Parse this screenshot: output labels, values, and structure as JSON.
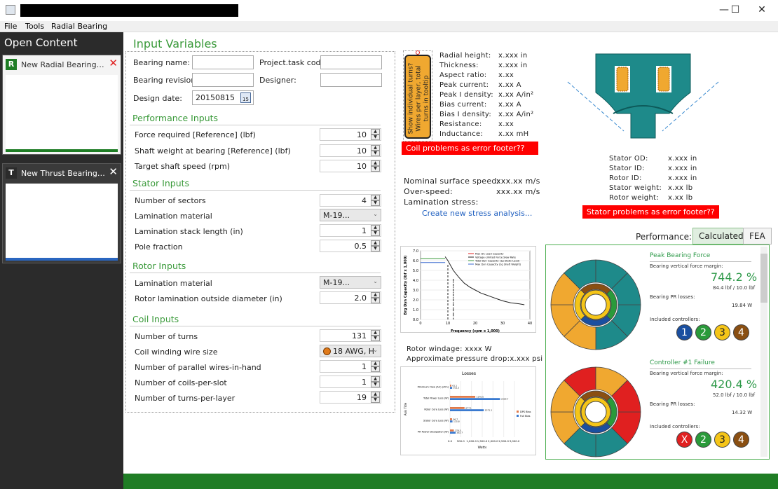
{
  "window": {
    "minimize": "—",
    "maximize": "☐",
    "close": "✕"
  },
  "menu": [
    "File",
    "Tools",
    "Radial Bearing"
  ],
  "sidebar": {
    "title": "Open Content",
    "cards": [
      {
        "badge": "R",
        "title": "New Radial Bearing Desi..."
      },
      {
        "badge": "T",
        "title": "New Thrust Bearing Des..."
      }
    ]
  },
  "input_vars": {
    "title": "Input Variables",
    "bearing_name_label": "Bearing name:",
    "project_task_label": "Project.task code:",
    "bearing_revision_label": "Bearing revision:",
    "designer_label": "Designer:",
    "design_date_label": "Design date:",
    "design_date": "20150815",
    "cal_num": "15",
    "sections": {
      "performance": "Performance Inputs",
      "stator": "Stator Inputs",
      "rotor": "Rotor Inputs",
      "coil": "Coil Inputs"
    },
    "performance": [
      {
        "label": "Force required [Reference] (lbf)",
        "value": "10"
      },
      {
        "label": "Shaft weight at bearing [Reference] (lbf)",
        "value": "10"
      },
      {
        "label": "Target shaft speed (rpm)",
        "value": "10"
      }
    ],
    "stator": {
      "sectors_label": "Number of sectors",
      "sectors": "4",
      "lam_label": "Lamination material",
      "lam_value": "M-19...",
      "stack_label": "Lamination stack length (in)",
      "stack": "1",
      "pole_label": "Pole fraction",
      "pole": "0.5"
    },
    "rotor": {
      "lam_label": "Lamination material",
      "lam_value": "M-19...",
      "od_label": "Rotor lamination outside diameter (in)",
      "od": "2.0"
    },
    "coil": {
      "turns_label": "Number of turns",
      "turns": "131",
      "wire_label": "Coil winding wire size",
      "wire": "18 AWG, H",
      "parallel_label": "Number of parallel wires-in-hand",
      "parallel": "1",
      "coils_label": "Number of coils-per-slot",
      "coils": "1",
      "layer_label": "Number of turns-per-layer",
      "layer": "19"
    }
  },
  "coil_tooltip": "Show individual turns? Wires per layer, total turns in tooltip",
  "coil_props": [
    [
      "Radial height:",
      "x.xxx in"
    ],
    [
      "Thickness:",
      "x.xxx in"
    ],
    [
      "Aspect ratio:",
      "x.xx"
    ],
    [
      "Peak current:",
      "x.xx A"
    ],
    [
      "Peak I density:",
      "x.xx A/in²"
    ],
    [
      "Bias current:",
      "x.xx A"
    ],
    [
      "Bias I density:",
      "x.xx A/in²"
    ],
    [
      "Resistance:",
      "x.xx"
    ],
    [
      "Inductance:",
      "x.xx mH"
    ]
  ],
  "coil_error": "Coil problems as error footer??",
  "surface": [
    [
      "Nominal surface speed:",
      "xxx.xx m/s"
    ],
    [
      "Over-speed:",
      "xxx.xx m/s"
    ],
    [
      "Lamination stress:",
      ""
    ]
  ],
  "stress_link": "Create new stress analysis...",
  "stator_props": [
    [
      "Stator OD:",
      "x.xxx in"
    ],
    [
      "Stator ID:",
      "x.xxx in"
    ],
    [
      "Rotor ID:",
      "x.xxx in"
    ],
    [
      "Stator weight:",
      "x.xx lb"
    ],
    [
      "Rotor weight:",
      "x.xx lb"
    ]
  ],
  "stator_error": "Stator problems as error footer??",
  "performance_panel": {
    "label": "Performance:",
    "tab_calc": "Calculated",
    "tab_fea": "FEA",
    "blocks": [
      {
        "title": "Peak Bearing Force",
        "margin_label": "Bearing vertical force margin:",
        "pct": "744.2 %",
        "sub": "84.4 lbf / 10.0 lbf",
        "loss_label": "Bearing PR losses:",
        "loss": "19.84 W",
        "ctrl_label": "Included controllers:",
        "ctrls": [
          "1",
          "2",
          "3",
          "4"
        ]
      },
      {
        "title": "Controller #1 Failure",
        "margin_label": "Bearing vertical force margin:",
        "pct": "420.4 %",
        "sub": "52.0 lbf / 10.0 lbf",
        "loss_label": "Bearing PR losses:",
        "loss": "14.32 W",
        "ctrl_label": "Included controllers:",
        "ctrls": [
          "X",
          "2",
          "3",
          "4"
        ]
      }
    ]
  },
  "windage": {
    "label": "Rotor windage:",
    "value": "xxxx W"
  },
  "pressure": {
    "label": "Approximate pressure drop:",
    "value": "x.xxx psi"
  },
  "colors": {
    "accent": "#3a9a3a",
    "ctrl1": "#1a4fa0",
    "ctrl2": "#2a9a3a",
    "ctrl3": "#f5c518",
    "ctrl4": "#8a4f12",
    "fail": "#e02020"
  },
  "chart_data": [
    {
      "type": "line",
      "ylabel": "Brg Dyn Capacity (lbf x 1,000)",
      "xlabel": "Frequency (cpm x 1,000)",
      "ylim": [
        0,
        7
      ],
      "xlim": [
        0,
        40
      ],
      "yticks": [
        "0.0",
        "1.0",
        "2.0",
        "3.0",
        "4.0",
        "5.0",
        "6.0",
        "7.0"
      ],
      "xticks": [
        "0",
        "10",
        "20",
        "30",
        "40"
      ],
      "legend": [
        "Max DC Load Capacity",
        "Voltage-Limited Force Slew Rate",
        "Total Dyn Capacity (1g Static Load)",
        "Max Dyn Capacity (1g Shaft Weight)"
      ],
      "series": [
        {
          "name": "Voltage-Limited Force Slew Rate",
          "x": [
            9,
            10,
            12,
            14,
            16,
            18,
            20,
            22,
            24,
            26,
            28,
            30,
            33,
            36,
            38
          ],
          "y": [
            6.4,
            6.0,
            5.0,
            4.3,
            3.7,
            3.3,
            3.0,
            2.7,
            2.5,
            2.3,
            2.1,
            1.9,
            1.7,
            1.6,
            1.5
          ]
        },
        {
          "name": "Total Dyn Capacity (1g Static Load)",
          "x": [
            0,
            9
          ],
          "y": [
            6.2,
            6.2
          ]
        },
        {
          "name": "Max Dyn Capacity (1g Shaft Weight)",
          "x": [
            0,
            9
          ],
          "y": [
            5.8,
            5.8
          ]
        }
      ]
    },
    {
      "type": "bar",
      "title": "Losses",
      "ylabel": "Axis Title",
      "xlabel": "Watts",
      "xticks": [
        "0.0",
        "500.0",
        "1,000.0",
        "1,500.0",
        "2,000.0",
        "2,500.0",
        "3,000.0"
      ],
      "categories": [
        "Minimum Flow (Air) (cfm)",
        "Total Power Loss (W)",
        "Rotor Core Loss (W)",
        "Stator Core Loss (W)",
        "PR Power Dissipation (W)"
      ],
      "series": [
        {
          "name": "DPS Bias",
          "values": [
            61.1,
            1176.5,
            677.1,
            96.7,
            178.5
          ]
        },
        {
          "name": "Full Bias",
          "values": [
            101.2,
            2329.7,
            1571.1,
            115.8,
            262.7
          ]
        }
      ]
    }
  ]
}
